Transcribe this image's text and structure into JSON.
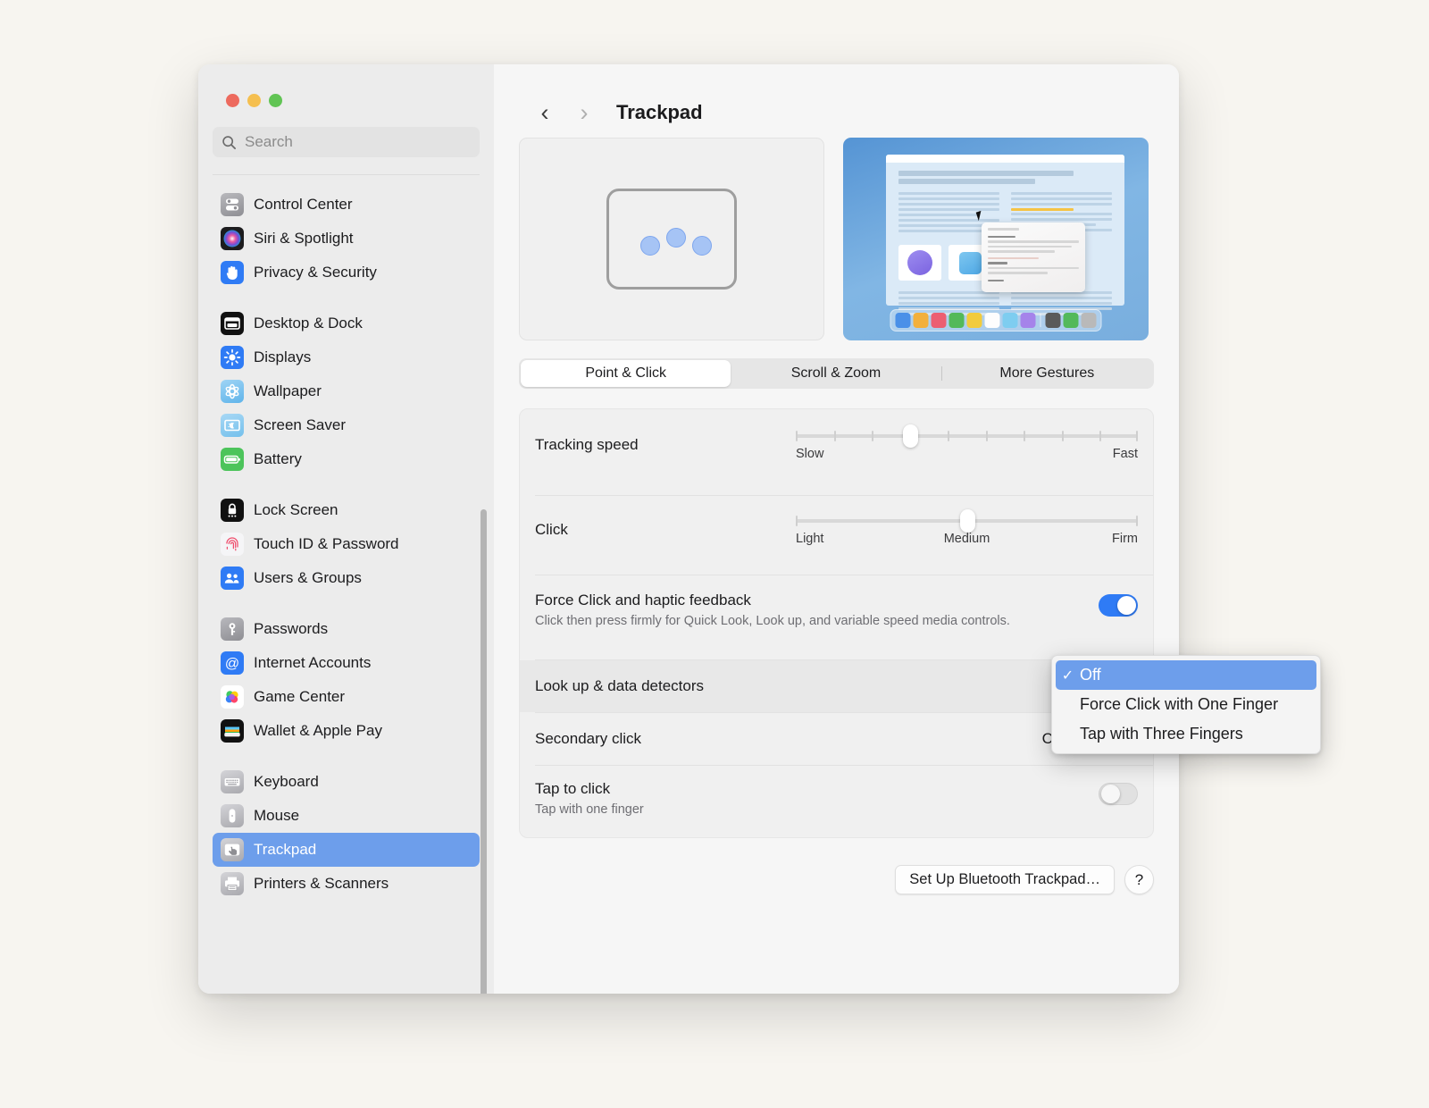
{
  "window": {
    "traffic_lights": [
      "close",
      "minimize",
      "zoom"
    ]
  },
  "sidebar": {
    "search": {
      "placeholder": "Search",
      "value": "",
      "icon": "search-icon"
    },
    "groups": [
      {
        "items": [
          {
            "label": "Control Center",
            "icon": "control-center-icon"
          },
          {
            "label": "Siri & Spotlight",
            "icon": "siri-icon"
          },
          {
            "label": "Privacy & Security",
            "icon": "privacy-hand-icon"
          }
        ]
      },
      {
        "items": [
          {
            "label": "Desktop & Dock",
            "icon": "desktop-dock-icon"
          },
          {
            "label": "Displays",
            "icon": "displays-icon"
          },
          {
            "label": "Wallpaper",
            "icon": "wallpaper-icon"
          },
          {
            "label": "Screen Saver",
            "icon": "screen-saver-icon"
          },
          {
            "label": "Battery",
            "icon": "battery-icon"
          }
        ]
      },
      {
        "items": [
          {
            "label": "Lock Screen",
            "icon": "lock-screen-icon"
          },
          {
            "label": "Touch ID & Password",
            "icon": "touch-id-icon"
          },
          {
            "label": "Users & Groups",
            "icon": "users-groups-icon"
          }
        ]
      },
      {
        "items": [
          {
            "label": "Passwords",
            "icon": "passwords-key-icon"
          },
          {
            "label": "Internet Accounts",
            "icon": "internet-accounts-icon"
          },
          {
            "label": "Game Center",
            "icon": "game-center-icon"
          },
          {
            "label": "Wallet & Apple Pay",
            "icon": "wallet-icon"
          }
        ]
      },
      {
        "items": [
          {
            "label": "Keyboard",
            "icon": "keyboard-icon"
          },
          {
            "label": "Mouse",
            "icon": "mouse-icon"
          },
          {
            "label": "Trackpad",
            "icon": "trackpad-icon",
            "selected": true
          },
          {
            "label": "Printers & Scanners",
            "icon": "printer-icon"
          }
        ]
      }
    ]
  },
  "header": {
    "back_icon": "chevron-left-icon",
    "forward_icon": "chevron-right-icon",
    "title": "Trackpad"
  },
  "previews": {
    "left": {
      "name": "trackpad-gesture-animation",
      "dots": 3
    },
    "right": {
      "name": "look-up-preview-animation"
    }
  },
  "tabs": [
    {
      "label": "Point & Click",
      "active": true
    },
    {
      "label": "Scroll & Zoom",
      "active": false
    },
    {
      "label": "More Gestures",
      "active": false
    }
  ],
  "settings": {
    "tracking_speed": {
      "label": "Tracking speed",
      "min_label": "Slow",
      "max_label": "Fast",
      "ticks": 10,
      "value_percent": 30
    },
    "click": {
      "label": "Click",
      "min_label": "Light",
      "mid_label": "Medium",
      "max_label": "Firm",
      "value_percent": 50
    },
    "force_click": {
      "label": "Force Click and haptic feedback",
      "description": "Click then press firmly for Quick Look, Look up, and variable speed media controls.",
      "enabled": true
    },
    "look_up": {
      "label": "Look up & data detectors",
      "value": "Off"
    },
    "secondary_click": {
      "label": "Secondary click",
      "value": "Click with Two"
    },
    "tap_to_click": {
      "label": "Tap to click",
      "description": "Tap with one finger",
      "enabled": false
    }
  },
  "footer": {
    "setup_button": "Set Up Bluetooth Trackpad…",
    "help_button": "?"
  },
  "dropdown": {
    "name": "look-up-data-detectors-menu",
    "items": [
      {
        "label": "Off",
        "selected": true,
        "check": "✓"
      },
      {
        "label": "Force Click with One Finger",
        "selected": false,
        "check": ""
      },
      {
        "label": "Tap with Three Fingers",
        "selected": false,
        "check": ""
      }
    ]
  },
  "colors": {
    "accent": "#6d9eeb",
    "toggle_on": "#2f7bf5",
    "window_bg": "#f2f2f2",
    "sidebar_bg": "#ececec",
    "desktop_bg": "#f7f5f0"
  }
}
